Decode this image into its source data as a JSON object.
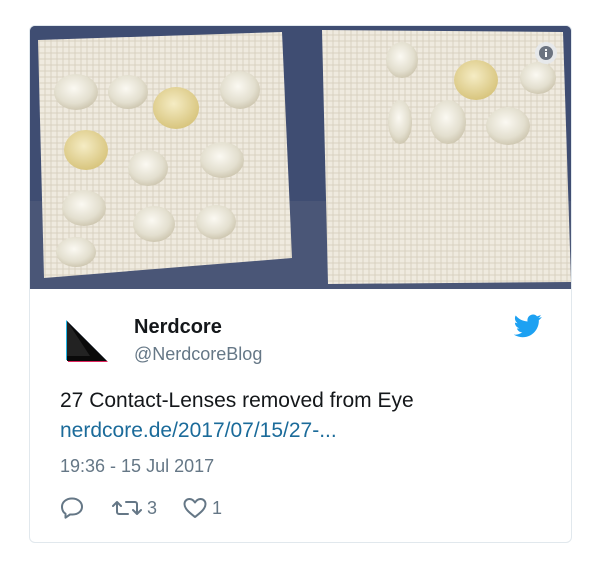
{
  "tweet": {
    "author_name": "Nerdcore",
    "author_handle": "@NerdcoreBlog",
    "text": "27 Contact-Lenses removed from Eye",
    "link_text": "nerdcore.de/2017/07/15/27-...",
    "timestamp": "19:36 - 15 Jul 2017",
    "retweet_count": "3",
    "like_count": "1"
  },
  "icons": {
    "twitter": "twitter-bird-icon",
    "info": "info-icon",
    "reply": "reply-icon",
    "retweet": "retweet-icon",
    "like": "heart-icon"
  },
  "colors": {
    "twitter_blue": "#1da1f2",
    "link": "#1b6b9a",
    "secondary_text": "#657786",
    "card_border": "#e1e8ed"
  }
}
